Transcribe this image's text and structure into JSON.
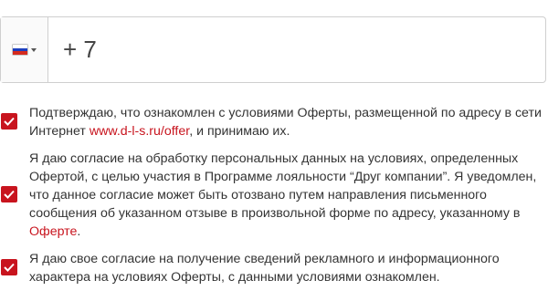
{
  "phone": {
    "value": "+ 7",
    "country_icon": "russia-flag-icon",
    "flag_colors": [
      "#ffffff",
      "#1c3fbf",
      "#d52b1e"
    ]
  },
  "accent_color": "#c8141e",
  "consents": [
    {
      "checked": true,
      "text_before": "Подтверждаю, что ознакомлен с условиями Оферты, размещенной по адресу в сети Интернет ",
      "link": "www.d-l-s.ru/offer",
      "text_after": ", и принимаю их."
    },
    {
      "checked": true,
      "text_before": "Я даю согласие на обработку персональных данных на условиях, определенных Офертой, с целью участия в Программе лояльности “Друг компании”. Я уведомлен, что данное согласие может быть отозвано путем направления письменного сообщения об указанном отзыве в произвольной форме по адресу, указанному в ",
      "link": "Оферте",
      "text_after": "."
    },
    {
      "checked": true,
      "text": "Я даю свое согласие на получение сведений рекламного и информационного характера на условиях Оферты, с данными условиями ознакомлен."
    }
  ]
}
